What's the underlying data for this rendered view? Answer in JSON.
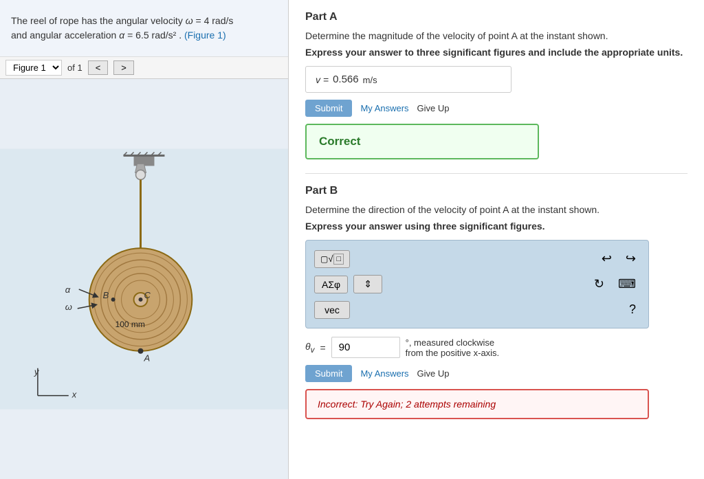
{
  "left": {
    "problem_text_1": "The reel of rope has the angular velocity ",
    "omega_label": "ω",
    "eq1": " = 4  rad/s",
    "problem_text_2": "and angular acceleration ",
    "alpha_label": "α",
    "eq2": " = 6.5  rad/s²",
    "figure_link": "(Figure 1)",
    "figure_label": "Figure 1",
    "of_label": "of 1",
    "prev_btn": "<",
    "next_btn": ">"
  },
  "right": {
    "part_a_label": "Part A",
    "part_a_desc": "Determine the magnitude of the velocity of point A at the instant shown.",
    "part_a_instruction": "Express your answer to three significant figures and include the appropriate units.",
    "answer_v_label": "v =",
    "answer_v_value": "0.566",
    "answer_v_unit": "m/s",
    "submit_a_label": "Submit",
    "my_answers_a": "My Answers",
    "give_up_a": "Give Up",
    "correct_label": "Correct",
    "part_b_label": "Part B",
    "part_b_desc": "Determine the direction of the velocity of point A at the instant shown.",
    "part_b_instruction": "Express your answer using three significant figures.",
    "tb_sqrt": "√□",
    "tb_undo": "↩",
    "tb_redo": "↪",
    "tb_AEphi": "ΑΣφ",
    "tb_updown": "⇕",
    "tb_refresh": "↻",
    "tb_keyboard": "⌨",
    "tb_vec": "vec",
    "tb_question": "?",
    "theta_label": "θᵥ",
    "eq_label": "=",
    "answer_b_value": "90",
    "degree_text": "°, measured clockwise",
    "from_text": "from the positive x-axis.",
    "submit_b_label": "Submit",
    "my_answers_b": "My Answers",
    "give_up_b": "Give Up",
    "incorrect_text": "Incorrect: Try Again; 2 attempts remaining"
  }
}
